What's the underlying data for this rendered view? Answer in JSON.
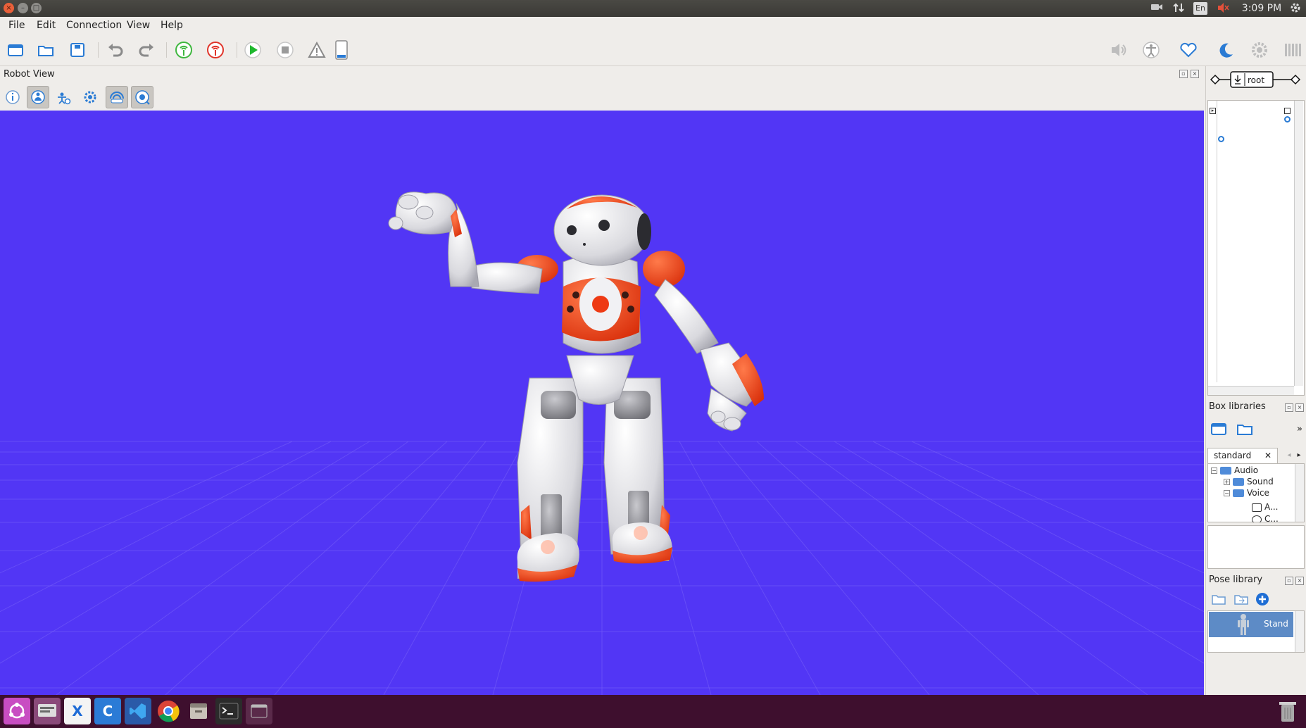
{
  "topbar": {
    "close_glyph": "×",
    "minimize_glyph": "–",
    "maximize_glyph": "□",
    "keyboard_layout": "En",
    "clock": "3:09 PM"
  },
  "menubar": [
    {
      "label": "File"
    },
    {
      "label": "Edit"
    },
    {
      "label": "Connection"
    },
    {
      "label": "View"
    },
    {
      "label": "Help"
    }
  ],
  "toolbar": {
    "icons": [
      "new-project-icon",
      "open-project-icon",
      "save-project-icon",
      "undo-icon",
      "redo-icon",
      "connect-icon",
      "disconnect-icon",
      "play-icon",
      "stop-icon",
      "warning-icon",
      "battery-icon"
    ],
    "right_icons": [
      "volume-icon",
      "motors-icon",
      "heart-icon",
      "rest-icon",
      "settings-icon",
      "more-icon"
    ]
  },
  "robot_view": {
    "title": "Robot View",
    "tools": [
      "info-icon",
      "view-3d-icon",
      "view-joints-icon",
      "view-settings-icon",
      "view-sonar-icon",
      "view-camera-icon"
    ]
  },
  "flow": {
    "root_label": "root"
  },
  "box_libraries": {
    "title": "Box libraries",
    "tab_label": "standard",
    "tab_close": "✕",
    "more": "»",
    "tree": [
      {
        "label": "Audio",
        "level": 0,
        "expander": "−",
        "kind": "folder"
      },
      {
        "label": "Sound",
        "level": 1,
        "expander": "+",
        "kind": "folder"
      },
      {
        "label": "Voice",
        "level": 1,
        "expander": "−",
        "kind": "folder"
      },
      {
        "label": "A...",
        "level": 2,
        "expander": "",
        "kind": "box"
      },
      {
        "label": "C...",
        "level": 2,
        "expander": "",
        "kind": "box"
      }
    ]
  },
  "pose_library": {
    "title": "Pose library",
    "poses": [
      {
        "label": "Stand",
        "selected": true
      }
    ]
  },
  "taskbar": {
    "apps": [
      "ubuntu-dash-icon",
      "choregraphe-icon",
      "xmind-icon",
      "c-app-icon",
      "vscode-icon",
      "chrome-icon",
      "files-icon",
      "terminal-icon",
      "window-icon"
    ],
    "vscode_letter": "X",
    "c_letter": "C"
  },
  "colors": {
    "scene_bg": "#5236f5",
    "robot_accent": "#ee3a14",
    "topbar": "#3e3d39",
    "taskbar": "#3e0f2e"
  }
}
